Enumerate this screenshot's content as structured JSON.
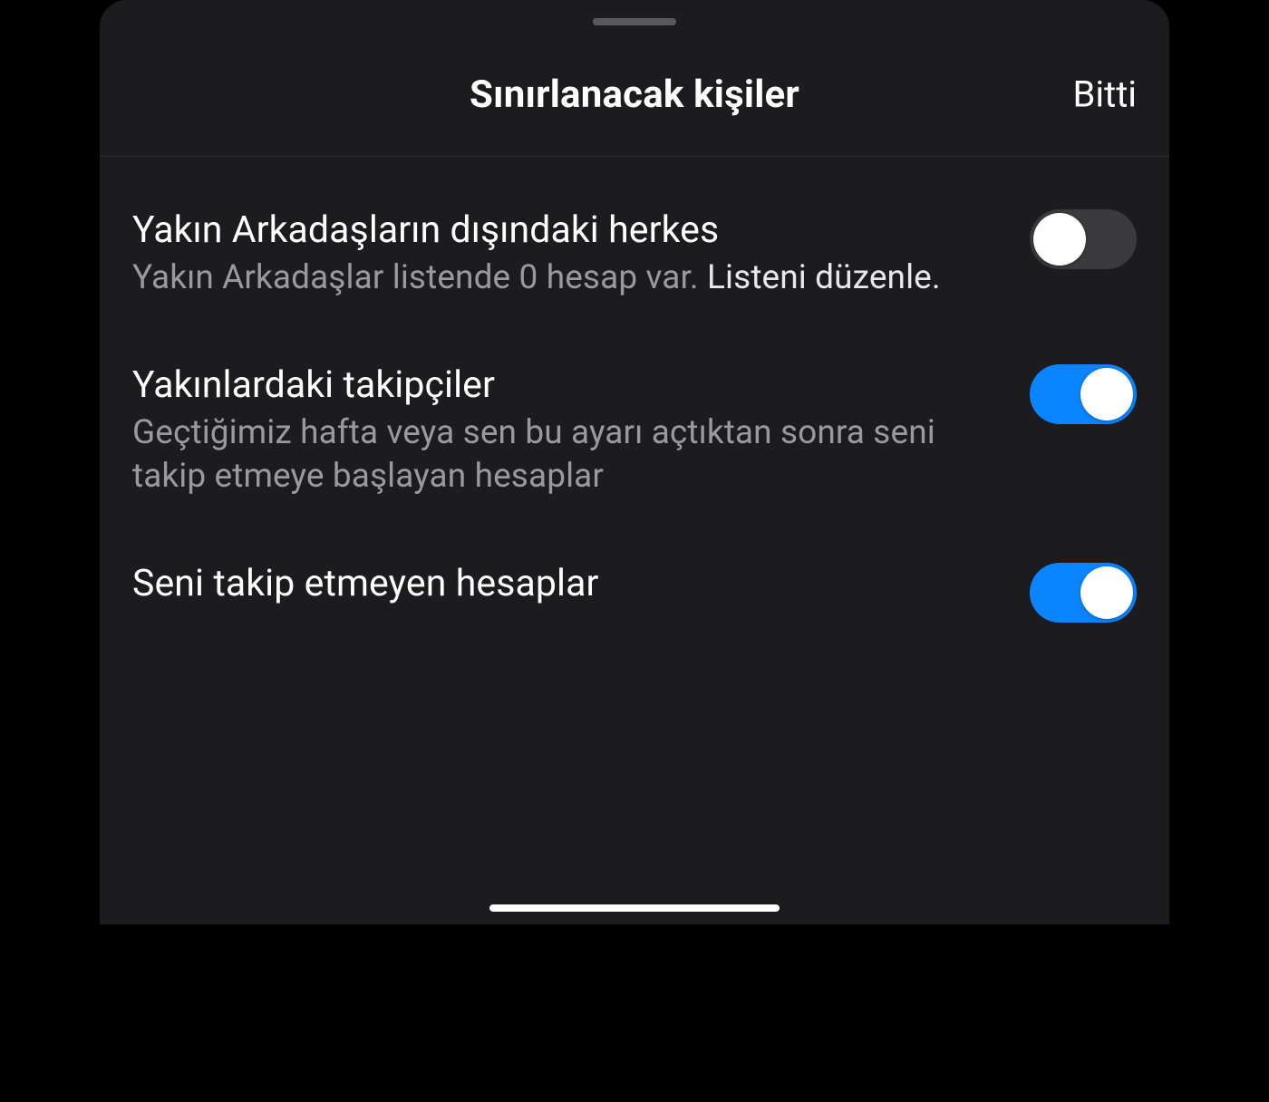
{
  "header": {
    "title": "Sınırlanacak kişiler",
    "done_label": "Bitti"
  },
  "settings": [
    {
      "title": "Yakın Arkadaşların dışındaki herkes",
      "desc_prefix": "Yakın Arkadaşlar listende 0 hesap var. ",
      "desc_link": "Listeni düzenle.",
      "on": false
    },
    {
      "title": "Yakınlardaki takipçiler",
      "desc_prefix": "Geçtiğimiz hafta veya sen bu ayarı açtıktan sonra seni takip etmeye başlayan hesaplar",
      "desc_link": "",
      "on": true
    },
    {
      "title": "Seni takip etmeyen hesaplar",
      "desc_prefix": "",
      "desc_link": "",
      "on": true
    }
  ],
  "colors": {
    "accent": "#0a84ff",
    "sheet_bg": "#1c1c1e",
    "text_primary": "#ffffff",
    "text_secondary": "#9a9a9c"
  }
}
